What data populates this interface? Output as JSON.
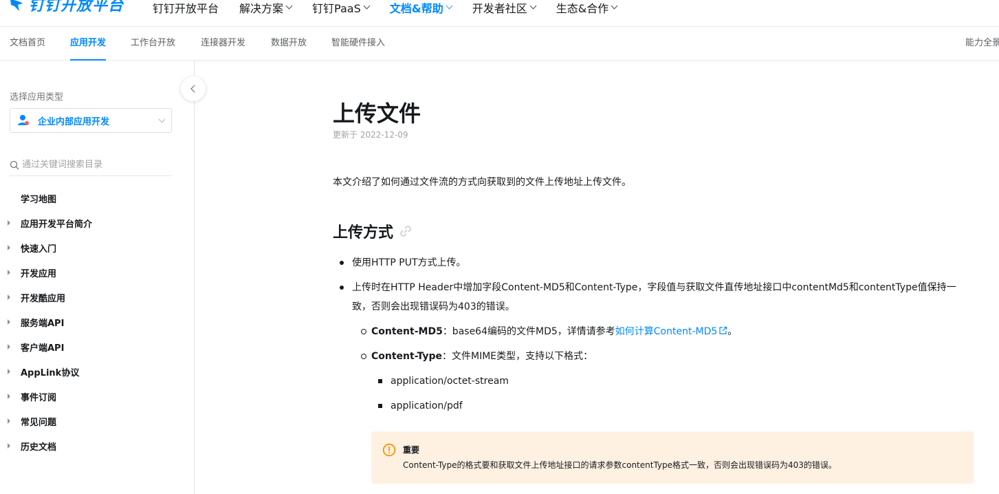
{
  "header": {
    "logo_text": "钉钉开放平台",
    "nav": [
      {
        "label": "钉钉开放平台",
        "has_dropdown": false,
        "active": false
      },
      {
        "label": "解决方案",
        "has_dropdown": true,
        "active": false
      },
      {
        "label": "钉钉PaaS",
        "has_dropdown": true,
        "active": false
      },
      {
        "label": "文档&帮助",
        "has_dropdown": true,
        "active": true
      },
      {
        "label": "开发者社区",
        "has_dropdown": true,
        "active": false
      },
      {
        "label": "生态&合作",
        "has_dropdown": true,
        "active": false
      }
    ]
  },
  "subnav": {
    "tabs": [
      {
        "label": "文档首页",
        "active": false
      },
      {
        "label": "应用开发",
        "active": true
      },
      {
        "label": "工作台开放",
        "active": false
      },
      {
        "label": "连接器开发",
        "active": false
      },
      {
        "label": "数据开放",
        "active": false
      },
      {
        "label": "智能硬件接入",
        "active": false
      }
    ],
    "right_label": "能力全景"
  },
  "sidebar": {
    "select_label": "选择应用类型",
    "selected_app_type": "企业内部应用开发",
    "search_placeholder": "通过关键词搜索目录",
    "toc": [
      {
        "label": "学习地图",
        "expandable": false
      },
      {
        "label": "应用开发平台简介",
        "expandable": true
      },
      {
        "label": "快速入门",
        "expandable": true
      },
      {
        "label": "开发应用",
        "expandable": true
      },
      {
        "label": "开发酷应用",
        "expandable": true
      },
      {
        "label": "服务端API",
        "expandable": true
      },
      {
        "label": "客户端API",
        "expandable": true
      },
      {
        "label": "AppLink协议",
        "expandable": true
      },
      {
        "label": "事件订阅",
        "expandable": true
      },
      {
        "label": "常见问题",
        "expandable": true
      },
      {
        "label": "历史文档",
        "expandable": true
      }
    ]
  },
  "article": {
    "title": "上传文件",
    "updated": "更新于 2022-12-09",
    "intro": "本文介绍了如何通过文件流的方式向获取到的文件上传地址上传文件。",
    "section_title": "上传方式",
    "bullet1": "使用HTTP PUT方式上传。",
    "bullet2": "上传时在HTTP Header中增加字段Content-MD5和Content-Type，字段值与获取文件直传地址接口中contentMd5和contentType值保持一致，否则会出现错误码为403的错误。",
    "sub1_key": "Content-MD5",
    "sub1_text": "：base64编码的文件MD5，详情请参考",
    "sub1_link": "如何计算Content-MD5",
    "sub1_end": "。",
    "sub2_key": "Content-Type",
    "sub2_text": "：文件MIME类型，支持以下格式：",
    "formats": [
      "application/octet-stream",
      "application/pdf"
    ],
    "notice_title": "重要",
    "notice_body": "Content-Type的格式要和获取文件上传地址接口的请求参数contentType格式一致，否则会出现错误码为403的错误。"
  },
  "colors": {
    "brand": "#0089ff",
    "notice_bg": "#fff1e2",
    "warning": "#ff9200"
  }
}
